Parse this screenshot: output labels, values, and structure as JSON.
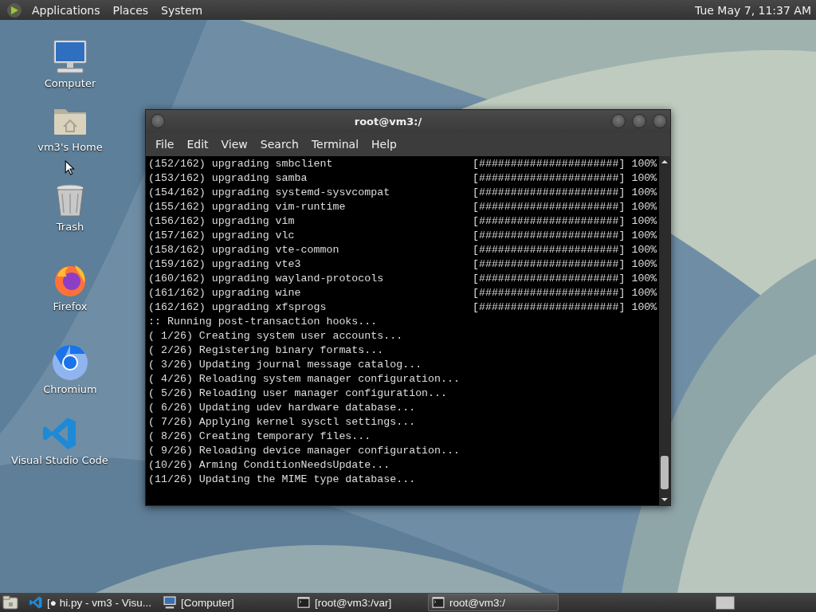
{
  "top_panel": {
    "menus": [
      "Applications",
      "Places",
      "System"
    ],
    "clock": "Tue May 7, 11:37 AM"
  },
  "desktop_icons": [
    {
      "kind": "computer",
      "label": "Computer"
    },
    {
      "kind": "home",
      "label": "vm3's Home"
    },
    {
      "kind": "trash",
      "label": "Trash"
    },
    {
      "kind": "firefox",
      "label": "Firefox"
    },
    {
      "kind": "chromium",
      "label": "Chromium"
    },
    {
      "kind": "vscode",
      "label": "Visual Studio Code"
    }
  ],
  "terminal_window": {
    "title": "root@vm3:/",
    "menus": [
      "File",
      "Edit",
      "View",
      "Search",
      "Terminal",
      "Help"
    ],
    "lines": [
      {
        "text": "(152/162) upgrading smbclient",
        "bar": "[######################]",
        "percent": "100%"
      },
      {
        "text": "(153/162) upgrading samba",
        "bar": "[######################]",
        "percent": "100%"
      },
      {
        "text": "(154/162) upgrading systemd-sysvcompat",
        "bar": "[######################]",
        "percent": "100%"
      },
      {
        "text": "(155/162) upgrading vim-runtime",
        "bar": "[######################]",
        "percent": "100%"
      },
      {
        "text": "(156/162) upgrading vim",
        "bar": "[######################]",
        "percent": "100%"
      },
      {
        "text": "(157/162) upgrading vlc",
        "bar": "[######################]",
        "percent": "100%"
      },
      {
        "text": "(158/162) upgrading vte-common",
        "bar": "[######################]",
        "percent": "100%"
      },
      {
        "text": "(159/162) upgrading vte3",
        "bar": "[######################]",
        "percent": "100%"
      },
      {
        "text": "(160/162) upgrading wayland-protocols",
        "bar": "[######################]",
        "percent": "100%"
      },
      {
        "text": "(161/162) upgrading wine",
        "bar": "[######################]",
        "percent": "100%"
      },
      {
        "text": "(162/162) upgrading xfsprogs",
        "bar": "[######################]",
        "percent": "100%"
      },
      {
        "text": ":: Running post-transaction hooks..."
      },
      {
        "text": "( 1/26) Creating system user accounts..."
      },
      {
        "text": "( 2/26) Registering binary formats..."
      },
      {
        "text": "( 3/26) Updating journal message catalog..."
      },
      {
        "text": "( 4/26) Reloading system manager configuration..."
      },
      {
        "text": "( 5/26) Reloading user manager configuration..."
      },
      {
        "text": "( 6/26) Updating udev hardware database..."
      },
      {
        "text": "( 7/26) Applying kernel sysctl settings..."
      },
      {
        "text": "( 8/26) Creating temporary files..."
      },
      {
        "text": "( 9/26) Reloading device manager configuration..."
      },
      {
        "text": "(10/26) Arming ConditionNeedsUpdate..."
      },
      {
        "text": "(11/26) Updating the MIME type database..."
      }
    ]
  },
  "taskbar": {
    "items": [
      {
        "kind": "vscode",
        "label": "[● hi.py - vm3 - Visu...",
        "selected": false
      },
      {
        "kind": "computer",
        "label": "[Computer]",
        "selected": false
      },
      {
        "kind": "terminal",
        "label": "[root@vm3:/var]",
        "selected": false
      },
      {
        "kind": "terminal",
        "label": "root@vm3:/",
        "selected": true
      }
    ]
  }
}
